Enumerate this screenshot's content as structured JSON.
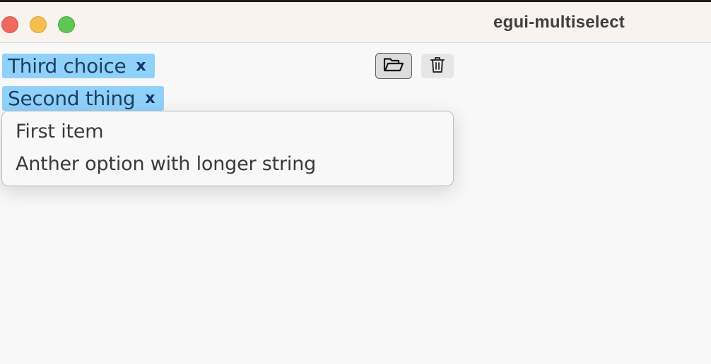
{
  "window": {
    "title": "egui-multiselect",
    "traffic_lights": {
      "close": "#ee6a5e",
      "minimize": "#f5be4f",
      "maximize": "#61c554"
    }
  },
  "selected_chips": [
    {
      "label": "Third choice",
      "remove_glyph": "x"
    },
    {
      "label": "Second thing",
      "remove_glyph": "x"
    }
  ],
  "toolbar": {
    "open_icon": "folder-open-icon",
    "delete_icon": "trash-icon"
  },
  "dropdown": {
    "options": [
      {
        "label": "First item"
      },
      {
        "label": "Anther option with longer string"
      }
    ]
  },
  "colors": {
    "chip_background": "#90d1fb",
    "chip_text": "#1e3f5e",
    "background": "#f8f8f8"
  }
}
